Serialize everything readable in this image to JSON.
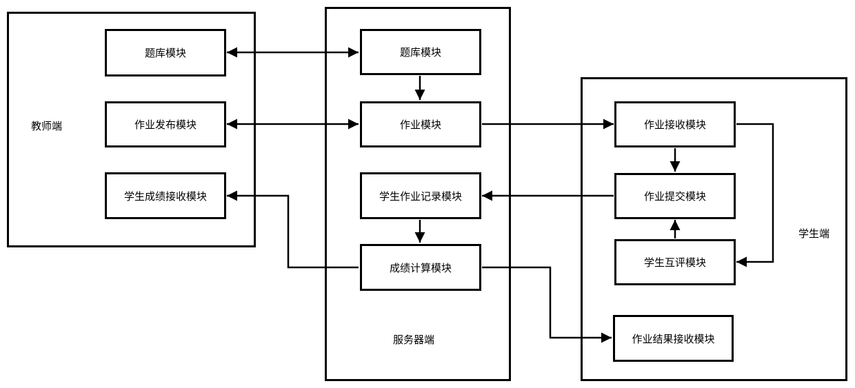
{
  "teacher": {
    "label": "教师端",
    "modules": {
      "question_bank": "题库模块",
      "assignment_publish": "作业发布模块",
      "grade_receive": "学生成绩接收模块"
    }
  },
  "server": {
    "label": "服务器端",
    "modules": {
      "question_bank": "题库模块",
      "assignment": "作业模块",
      "submission_record": "学生作业记录模块",
      "grade_calc": "成绩计算模块"
    }
  },
  "student": {
    "label": "学生端",
    "modules": {
      "assignment_receive": "作业接收模块",
      "assignment_submit": "作业提交模块",
      "peer_review": "学生互评模块",
      "result_receive": "作业结果接收模块"
    }
  },
  "connections": [
    {
      "from": "teacher.question_bank",
      "to": "server.question_bank",
      "direction": "bidirectional"
    },
    {
      "from": "teacher.assignment_publish",
      "to": "server.assignment",
      "direction": "bidirectional"
    },
    {
      "from": "server.question_bank",
      "to": "server.assignment",
      "direction": "forward"
    },
    {
      "from": "server.assignment",
      "to": "student.assignment_receive",
      "direction": "forward"
    },
    {
      "from": "student.assignment_receive",
      "to": "student.assignment_submit",
      "direction": "forward"
    },
    {
      "from": "student.assignment_receive",
      "to": "student.peer_review",
      "direction": "forward"
    },
    {
      "from": "student.peer_review",
      "to": "student.assignment_submit",
      "direction": "forward"
    },
    {
      "from": "student.assignment_submit",
      "to": "server.submission_record",
      "direction": "forward"
    },
    {
      "from": "server.submission_record",
      "to": "server.grade_calc",
      "direction": "forward"
    },
    {
      "from": "server.grade_calc",
      "to": "teacher.grade_receive",
      "direction": "forward"
    },
    {
      "from": "server.grade_calc",
      "to": "student.result_receive",
      "direction": "forward"
    }
  ]
}
